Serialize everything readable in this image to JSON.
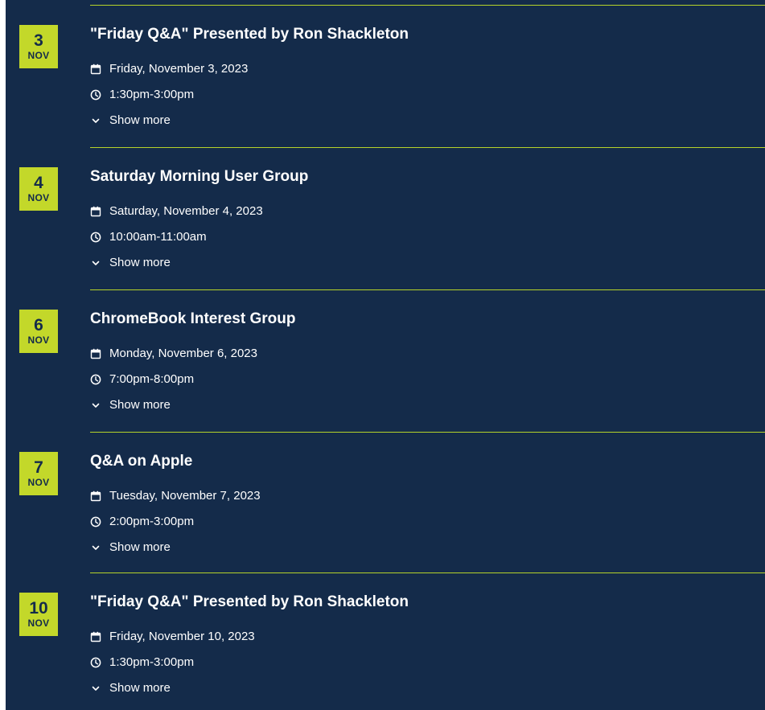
{
  "colors": {
    "background": "#142b4a",
    "accent": "#c3d82a",
    "divider": "#b6d32a",
    "text": "#ffffff"
  },
  "icons": {
    "date": "calendar-icon",
    "time": "clock-icon",
    "more": "chevron-down-icon"
  },
  "events": [
    {
      "day": "3",
      "month": "NOV",
      "title": "\"Friday Q&A\" Presented by Ron Shackleton",
      "date": "Friday, November 3, 2023",
      "time": "1:30pm-3:00pm",
      "more": "Show more"
    },
    {
      "day": "4",
      "month": "NOV",
      "title": "Saturday Morning User Group",
      "date": "Saturday, November 4, 2023",
      "time": "10:00am-11:00am",
      "more": "Show more"
    },
    {
      "day": "6",
      "month": "NOV",
      "title": "ChromeBook Interest Group",
      "date": "Monday, November 6, 2023",
      "time": "7:00pm-8:00pm",
      "more": "Show more"
    },
    {
      "day": "7",
      "month": "NOV",
      "title": "Q&A on Apple",
      "date": "Tuesday, November 7, 2023",
      "time": "2:00pm-3:00pm",
      "more": "Show more"
    },
    {
      "day": "10",
      "month": "NOV",
      "title": "\"Friday Q&A\" Presented by Ron Shackleton",
      "date": "Friday, November 10, 2023",
      "time": "1:30pm-3:00pm",
      "more": "Show more"
    }
  ]
}
